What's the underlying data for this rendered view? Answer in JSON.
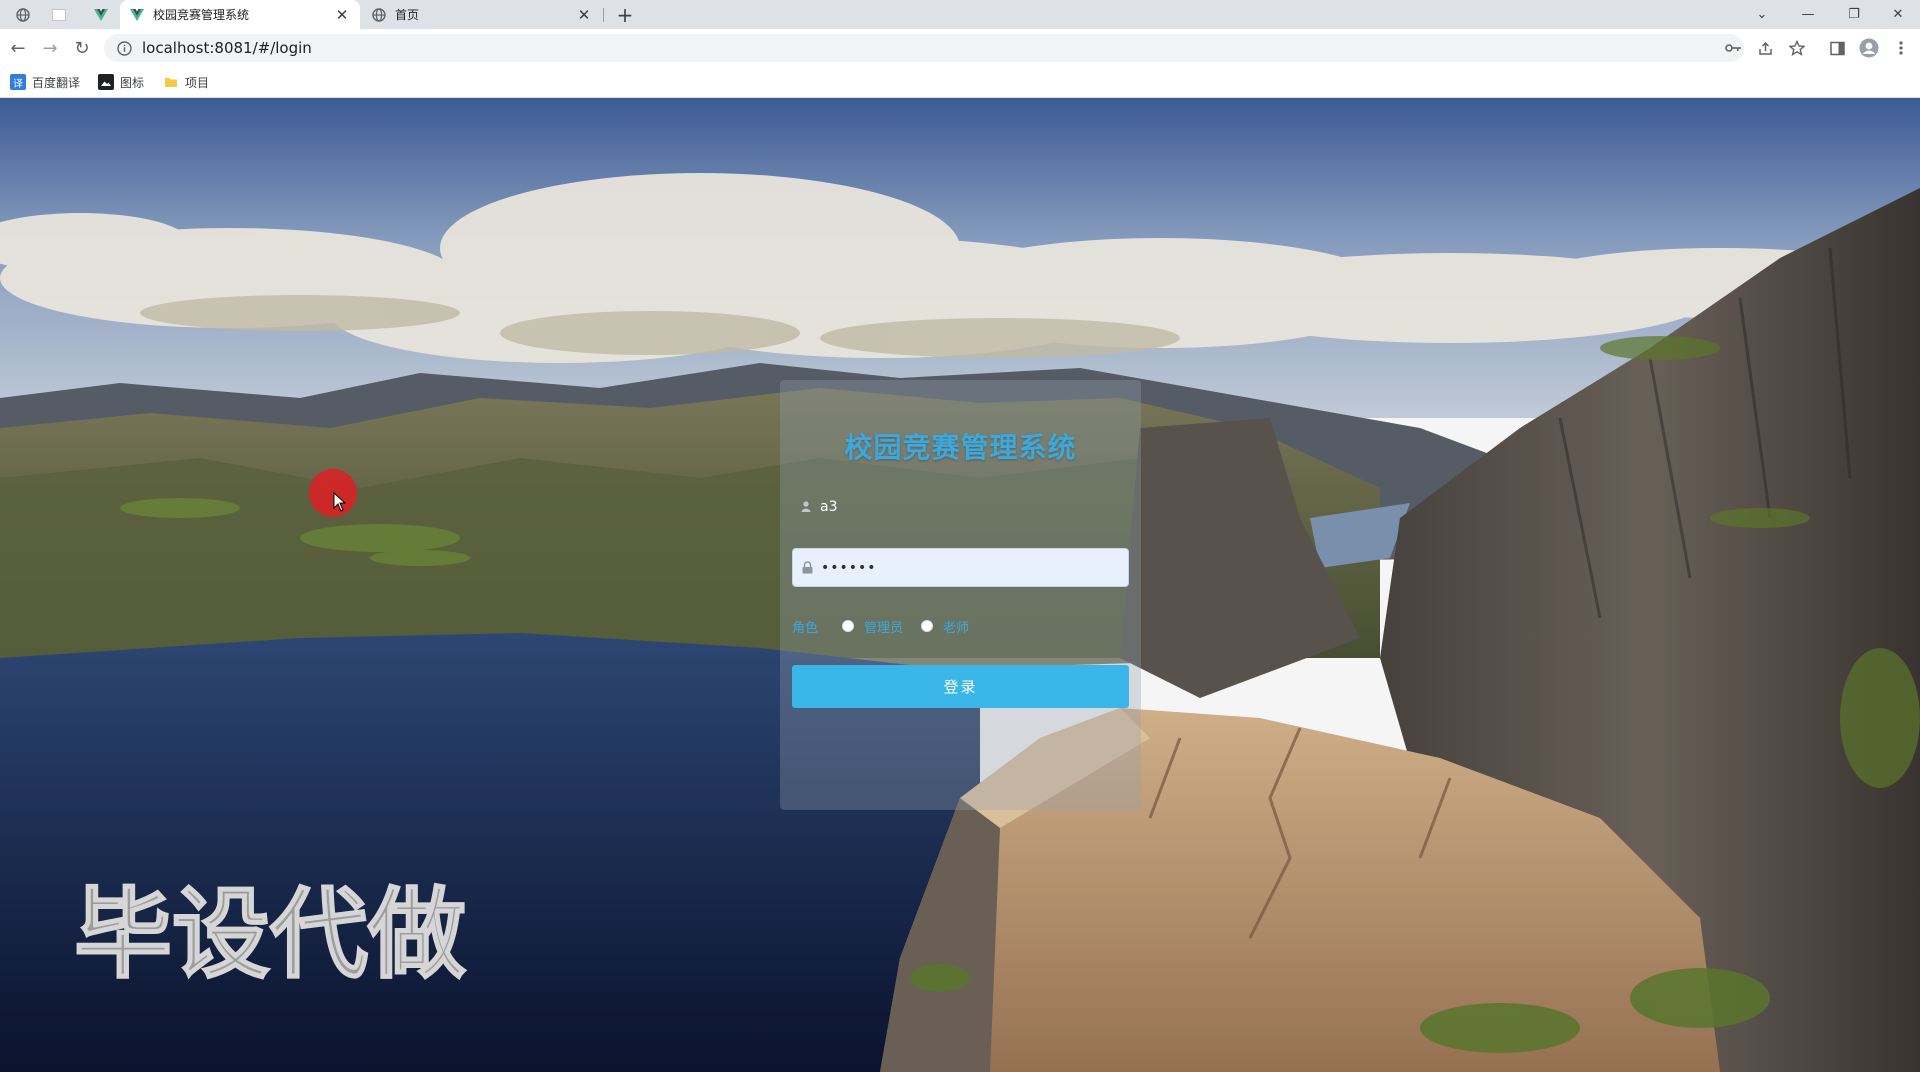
{
  "browser": {
    "tabs": [
      {
        "title": "校园竞赛管理系统",
        "active": true
      },
      {
        "title": "首页",
        "active": false
      }
    ],
    "url": {
      "host": "localhost",
      "path": ":8081/#/login"
    },
    "bookmarks": [
      {
        "label": "百度翻译",
        "icon": "translate-icon"
      },
      {
        "label": "图标",
        "icon": "image-icon"
      },
      {
        "label": "项目",
        "icon": "folder-icon"
      }
    ]
  },
  "login": {
    "title": "校园竞赛管理系统",
    "username": "a3",
    "password": "••••••",
    "role_label": "角色",
    "roles": [
      "管理员",
      "老师"
    ],
    "submit": "登录"
  },
  "watermark": "毕设代做",
  "colors": {
    "accent": "#3ba8de",
    "button": "#3ab7e8",
    "password_field": "#e8f0fe",
    "cursor_highlight": "#e11e23"
  }
}
